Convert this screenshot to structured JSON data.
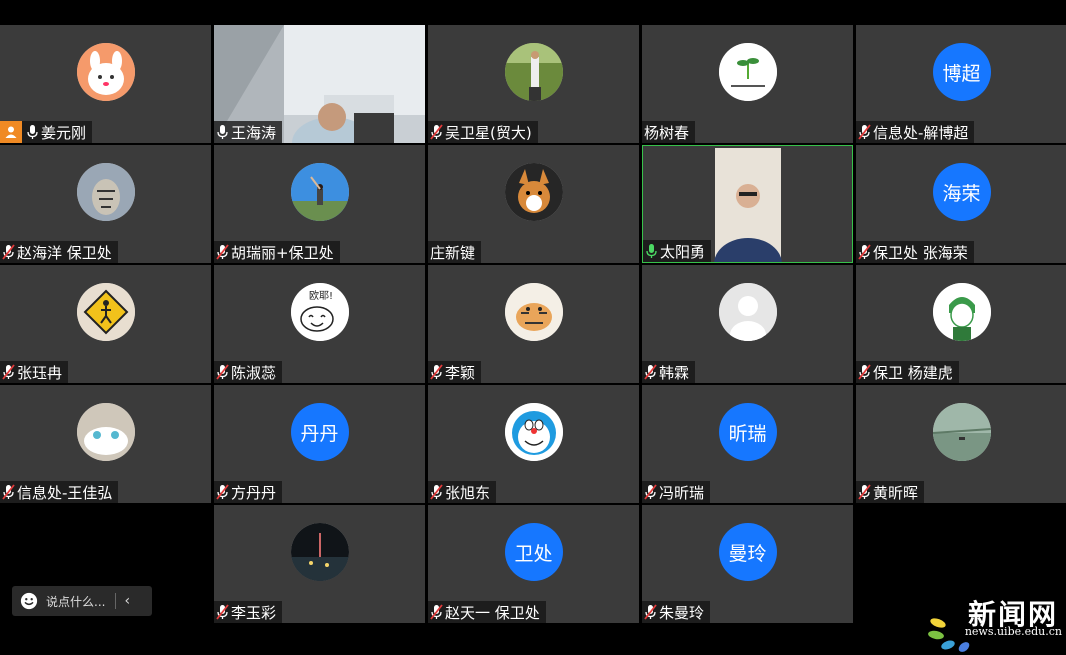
{
  "participants": [
    {
      "name": "姜元刚",
      "mic": "on",
      "host": true,
      "avatar": {
        "kind": "cartoon-bunny"
      }
    },
    {
      "name": "王海涛",
      "mic": "on",
      "avatar": {
        "kind": "video-office"
      }
    },
    {
      "name": "吴卫星(贸大)",
      "mic": "muted",
      "avatar": {
        "kind": "photo-forest"
      }
    },
    {
      "name": "杨树春",
      "mic": "none",
      "avatar": {
        "kind": "sprout-logo"
      }
    },
    {
      "name": "信息处-解博超",
      "mic": "muted",
      "avatar": {
        "kind": "text",
        "text": "博超"
      }
    },
    {
      "name": "赵海洋 保卫处",
      "mic": "muted",
      "avatar": {
        "kind": "photo-tiger"
      }
    },
    {
      "name": "胡瑞丽+保卫处",
      "mic": "muted",
      "avatar": {
        "kind": "photo-sky"
      }
    },
    {
      "name": "庄新键",
      "mic": "none",
      "avatar": {
        "kind": "photo-corgi"
      }
    },
    {
      "name": "太阳勇",
      "mic": "active",
      "active": true,
      "avatar": {
        "kind": "video-man"
      }
    },
    {
      "name": "保卫处 张海荣",
      "mic": "muted",
      "avatar": {
        "kind": "text",
        "text": "海荣"
      }
    },
    {
      "name": "张珏冉",
      "mic": "muted",
      "avatar": {
        "kind": "sign-pedestrian"
      }
    },
    {
      "name": "陈淑蕊",
      "mic": "muted",
      "avatar": {
        "kind": "doodle-face",
        "text": "欧耶!"
      }
    },
    {
      "name": "李颖",
      "mic": "muted",
      "avatar": {
        "kind": "cartoon-tiger"
      }
    },
    {
      "name": "韩霖",
      "mic": "muted",
      "avatar": {
        "kind": "default-person"
      }
    },
    {
      "name": "保卫 杨建虎",
      "mic": "muted",
      "avatar": {
        "kind": "anime-green"
      }
    },
    {
      "name": "信息处-王佳弘",
      "mic": "muted",
      "avatar": {
        "kind": "photo-cat"
      }
    },
    {
      "name": "方丹丹",
      "mic": "muted",
      "avatar": {
        "kind": "text",
        "text": "丹丹"
      }
    },
    {
      "name": "张旭东",
      "mic": "muted",
      "avatar": {
        "kind": "doraemon"
      }
    },
    {
      "name": "冯昕瑞",
      "mic": "muted",
      "avatar": {
        "kind": "text",
        "text": "昕瑞"
      }
    },
    {
      "name": "黄昕晖",
      "mic": "muted",
      "avatar": {
        "kind": "photo-lake"
      }
    },
    {
      "name": "李玉彩",
      "mic": "muted",
      "avatar": {
        "kind": "photo-night"
      }
    },
    {
      "name": "赵天一 保卫处",
      "mic": "muted",
      "avatar": {
        "kind": "text",
        "text": "卫处"
      }
    },
    {
      "name": "朱曼玲",
      "mic": "muted",
      "avatar": {
        "kind": "text",
        "text": "曼玲"
      }
    }
  ],
  "chat": {
    "placeholder": "说点什么..."
  },
  "watermark": {
    "title": "新闻网",
    "url": "news.uibe.edu.cn"
  },
  "colors": {
    "tile": "#3b3b3b",
    "accent": "#1677ff",
    "active_border": "#37c24a",
    "muted": "#e23b3b",
    "host": "#f08a24"
  }
}
